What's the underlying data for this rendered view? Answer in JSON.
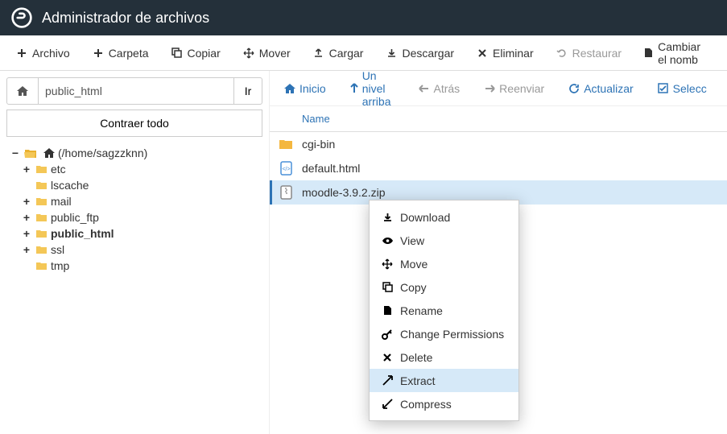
{
  "header": {
    "title": "Administrador de archivos"
  },
  "toolbar": {
    "archivo": "Archivo",
    "carpeta": "Carpeta",
    "copiar": "Copiar",
    "mover": "Mover",
    "cargar": "Cargar",
    "descargar": "Descargar",
    "eliminar": "Eliminar",
    "restaurar": "Restaurar",
    "cambiar": "Cambiar el nomb"
  },
  "left": {
    "path_value": "public_html",
    "go": "Ir",
    "collapse": "Contraer todo",
    "tree": {
      "root": "(/home/sagzzknn)",
      "items": [
        {
          "label": "etc",
          "toggle": "+"
        },
        {
          "label": "lscache",
          "toggle": ""
        },
        {
          "label": "mail",
          "toggle": "+"
        },
        {
          "label": "public_ftp",
          "toggle": "+"
        },
        {
          "label": "public_html",
          "toggle": "+",
          "bold": true
        },
        {
          "label": "ssl",
          "toggle": "+"
        },
        {
          "label": "tmp",
          "toggle": ""
        }
      ]
    }
  },
  "nav": {
    "inicio": "Inicio",
    "nivel": "Un nivel arriba",
    "atras": "Atrás",
    "reenviar": "Reenviar",
    "actualizar": "Actualizar",
    "selecc": "Selecc"
  },
  "table": {
    "header_name": "Name",
    "rows": [
      {
        "name": "cgi-bin",
        "type": "folder"
      },
      {
        "name": "default.html",
        "type": "html"
      },
      {
        "name": "moodle-3.9.2.zip",
        "type": "zip",
        "selected": true
      }
    ]
  },
  "ctx": {
    "download": "Download",
    "view": "View",
    "move": "Move",
    "copy": "Copy",
    "rename": "Rename",
    "perms": "Change Permissions",
    "delete": "Delete",
    "extract": "Extract",
    "compress": "Compress"
  }
}
